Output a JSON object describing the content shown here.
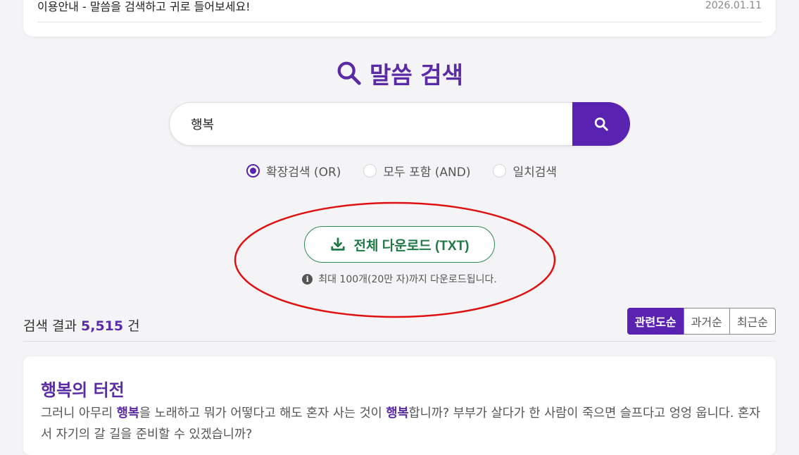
{
  "notice": {
    "title": "이용안내 - 말씀을 검색하고 귀로 들어보세요!",
    "date": "2026.01.11"
  },
  "search": {
    "heading": "말씀 검색",
    "query": "행복",
    "modes": [
      {
        "label": "확장검색 (OR)",
        "selected": true
      },
      {
        "label": "모두 포함 (AND)",
        "selected": false
      },
      {
        "label": "일치검색",
        "selected": false
      }
    ]
  },
  "download": {
    "label": "전체 다운로드 (TXT)",
    "note": "최대 100개(20만 자)까지 다운로드됩니다."
  },
  "results": {
    "prefix": "검색 결과",
    "count": "5,515",
    "suffix": "건",
    "sort_options": [
      {
        "label": "관련도순",
        "active": true
      },
      {
        "label": "과거순",
        "active": false
      },
      {
        "label": "최근순",
        "active": false
      }
    ]
  },
  "result_item": {
    "title": "행복의 터전",
    "body_parts": [
      {
        "text": "그러니 아무리 ",
        "highlight": false
      },
      {
        "text": "행복",
        "highlight": true
      },
      {
        "text": "을 노래하고 뭐가 어떻다고 해도 혼자 사는 것이 ",
        "highlight": false
      },
      {
        "text": "행복",
        "highlight": true
      },
      {
        "text": "합니까? 부부가 살다가 한 사람이 죽으면 슬프다고 엉엉 웁니다. 혼자서 자기의 갈 길을 준비할 수 있겠습니까?",
        "highlight": false
      }
    ]
  },
  "colors": {
    "accent": "#5a22b0",
    "download_green": "#2e8b57",
    "annotation_red": "#e01010"
  }
}
